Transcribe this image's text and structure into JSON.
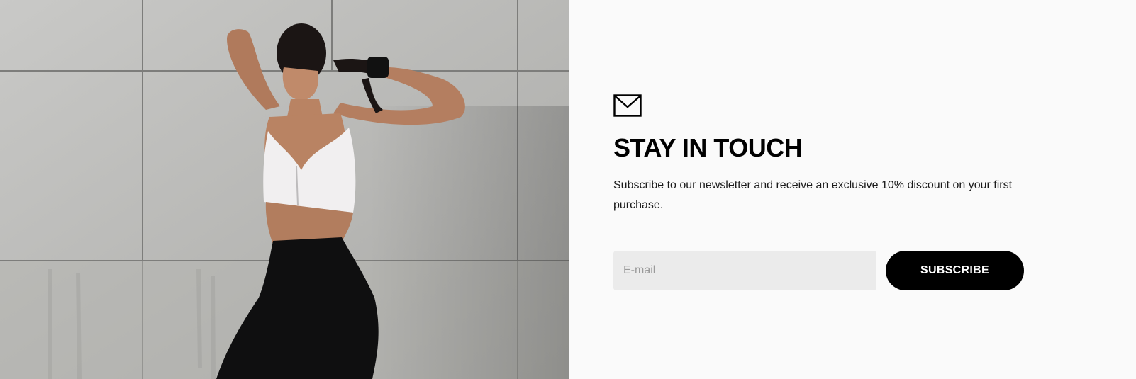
{
  "photo": {
    "description_icon": "photo-image"
  },
  "newsletter": {
    "icon": "mail-icon",
    "title": "STAY IN TOUCH",
    "description": "Subscribe to our newsletter and receive an exclusive 10% discount on your first purchase.",
    "email_placeholder": "E-mail",
    "email_value": "",
    "button_label": "SUBSCRIBE"
  },
  "colors": {
    "panel_background": "#fafafa",
    "input_background": "#ebebeb",
    "button_background": "#000000",
    "button_text": "#ffffff"
  }
}
